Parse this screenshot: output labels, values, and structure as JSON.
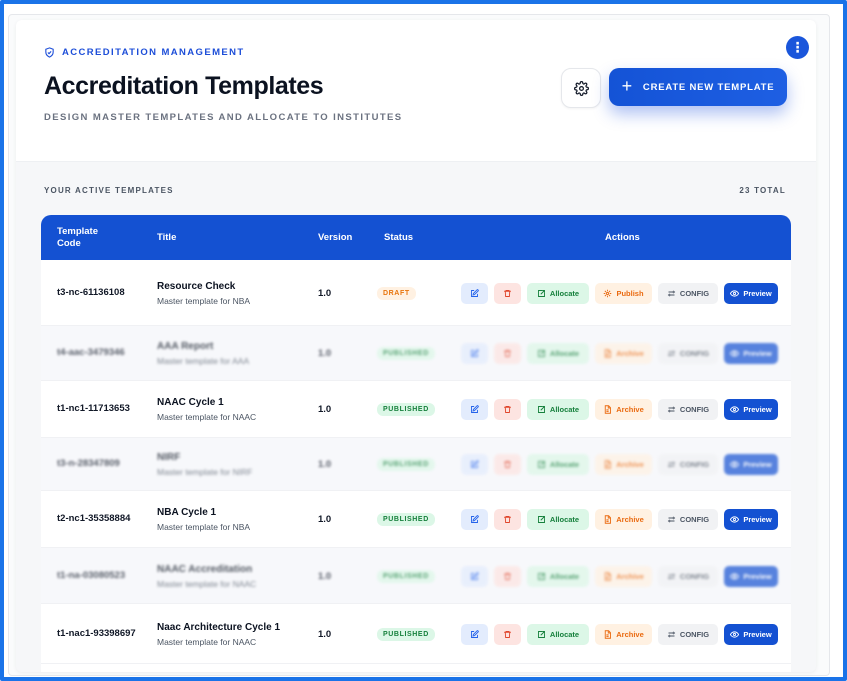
{
  "header": {
    "eyebrow": "ACCREDITATION MANAGEMENT",
    "title": "Accreditation Templates",
    "subtitle": "DESIGN MASTER TEMPLATES AND ALLOCATE TO INSTITUTES",
    "create_label": "CREATE NEW TEMPLATE",
    "more_label": "⋮"
  },
  "list": {
    "section_label": "YOUR ACTIVE TEMPLATES",
    "total_label": "23 TOTAL"
  },
  "table": {
    "columns": {
      "code": "Template Code",
      "title": "Title",
      "version": "Version",
      "status": "Status",
      "actions": "Actions"
    },
    "action_labels": {
      "allocate": "Allocate",
      "publish": "Publish",
      "archive": "Archive",
      "config": "CONFIG",
      "preview": "Preview"
    },
    "rows": [
      {
        "code": "t3-nc-61136108",
        "title": "Resource Check",
        "subtitle": "Master template for NBA",
        "version": "1.0",
        "status": "DRAFT",
        "status_kind": "draft",
        "blurred": false
      },
      {
        "code": "t4-aac-3479346",
        "title": "AAA Report",
        "subtitle": "Master template for AAA",
        "version": "1.0",
        "status": "PUBLISHED",
        "status_kind": "published",
        "blurred": true
      },
      {
        "code": "t1-nc1-11713653",
        "title": "NAAC Cycle 1",
        "subtitle": "Master template for NAAC",
        "version": "1.0",
        "status": "PUBLISHED",
        "status_kind": "published",
        "blurred": false
      },
      {
        "code": "t3-n-28347809",
        "title": "NIRF",
        "subtitle": "Master template for NIRF",
        "version": "1.0",
        "status": "PUBLISHED",
        "status_kind": "published",
        "blurred": true
      },
      {
        "code": "t2-nc1-35358884",
        "title": "NBA Cycle 1",
        "subtitle": "Master template for NBA",
        "version": "1.0",
        "status": "PUBLISHED",
        "status_kind": "published",
        "blurred": false
      },
      {
        "code": "t1-na-03080523",
        "title": "NAAC Accreditation",
        "subtitle": "Master template for NAAC",
        "version": "1.0",
        "status": "PUBLISHED",
        "status_kind": "published",
        "blurred": true
      },
      {
        "code": "t1-nac1-93398697",
        "title": "Naac Architecture Cycle 1",
        "subtitle": "Master template for NAAC",
        "version": "1.0",
        "status": "PUBLISHED",
        "status_kind": "published",
        "blurred": false
      }
    ]
  },
  "colors": {
    "primary": "#1451d2",
    "published_bg": "#dcf7e7",
    "published_fg": "#16803c",
    "draft_bg": "#fff1e2",
    "draft_fg": "#e8740c",
    "delete_fg": "#e0452b"
  },
  "icons": {
    "eyebrow": "shield-check-icon",
    "settings": "gear-icon",
    "create": "plus-icon",
    "edit": "pencil-square-icon",
    "delete": "trash-icon",
    "allocate": "arrow-box-icon",
    "publish": "sparkle-icon",
    "archive": "document-icon",
    "config": "sliders-icon",
    "preview": "eye-icon",
    "more": "kebab-icon"
  }
}
